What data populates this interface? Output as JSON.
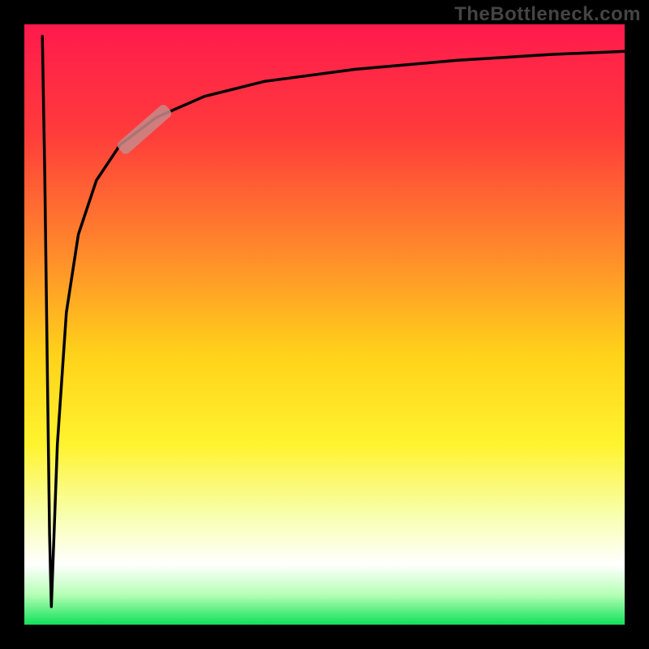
{
  "watermark": "TheBottleneck.com",
  "colors": {
    "background": "#000000",
    "gradient_stops": [
      {
        "offset": 0.0,
        "color": "#ff1a4d"
      },
      {
        "offset": 0.18,
        "color": "#ff3b3b"
      },
      {
        "offset": 0.38,
        "color": "#ff8a2b"
      },
      {
        "offset": 0.55,
        "color": "#ffd21a"
      },
      {
        "offset": 0.7,
        "color": "#fff32e"
      },
      {
        "offset": 0.82,
        "color": "#f8ffb0"
      },
      {
        "offset": 0.9,
        "color": "#ffffff"
      },
      {
        "offset": 0.95,
        "color": "#b5ffb5"
      },
      {
        "offset": 1.0,
        "color": "#11e05a"
      }
    ],
    "curve": "#000000",
    "marker": "#c78a88"
  },
  "chart_data": {
    "type": "line",
    "title": "",
    "xlabel": "",
    "ylabel": "",
    "xlim": [
      0,
      100
    ],
    "ylim": [
      0,
      100
    ],
    "legend": null,
    "annotations": [],
    "series": [
      {
        "name": "descent",
        "x": [
          3.0,
          3.4,
          3.8,
          4.2,
          4.5
        ],
        "values": [
          98,
          75,
          45,
          15,
          3
        ]
      },
      {
        "name": "bottleneck-curve",
        "x": [
          4.5,
          5.5,
          7,
          9,
          12,
          16,
          22,
          30,
          40,
          55,
          72,
          88,
          100
        ],
        "values": [
          3,
          30,
          52,
          65,
          74,
          80,
          84.5,
          88,
          90.5,
          92.5,
          94,
          95,
          95.5
        ]
      }
    ],
    "marker": {
      "x_range": [
        16,
        24
      ],
      "y_range": [
        79,
        86
      ]
    }
  }
}
